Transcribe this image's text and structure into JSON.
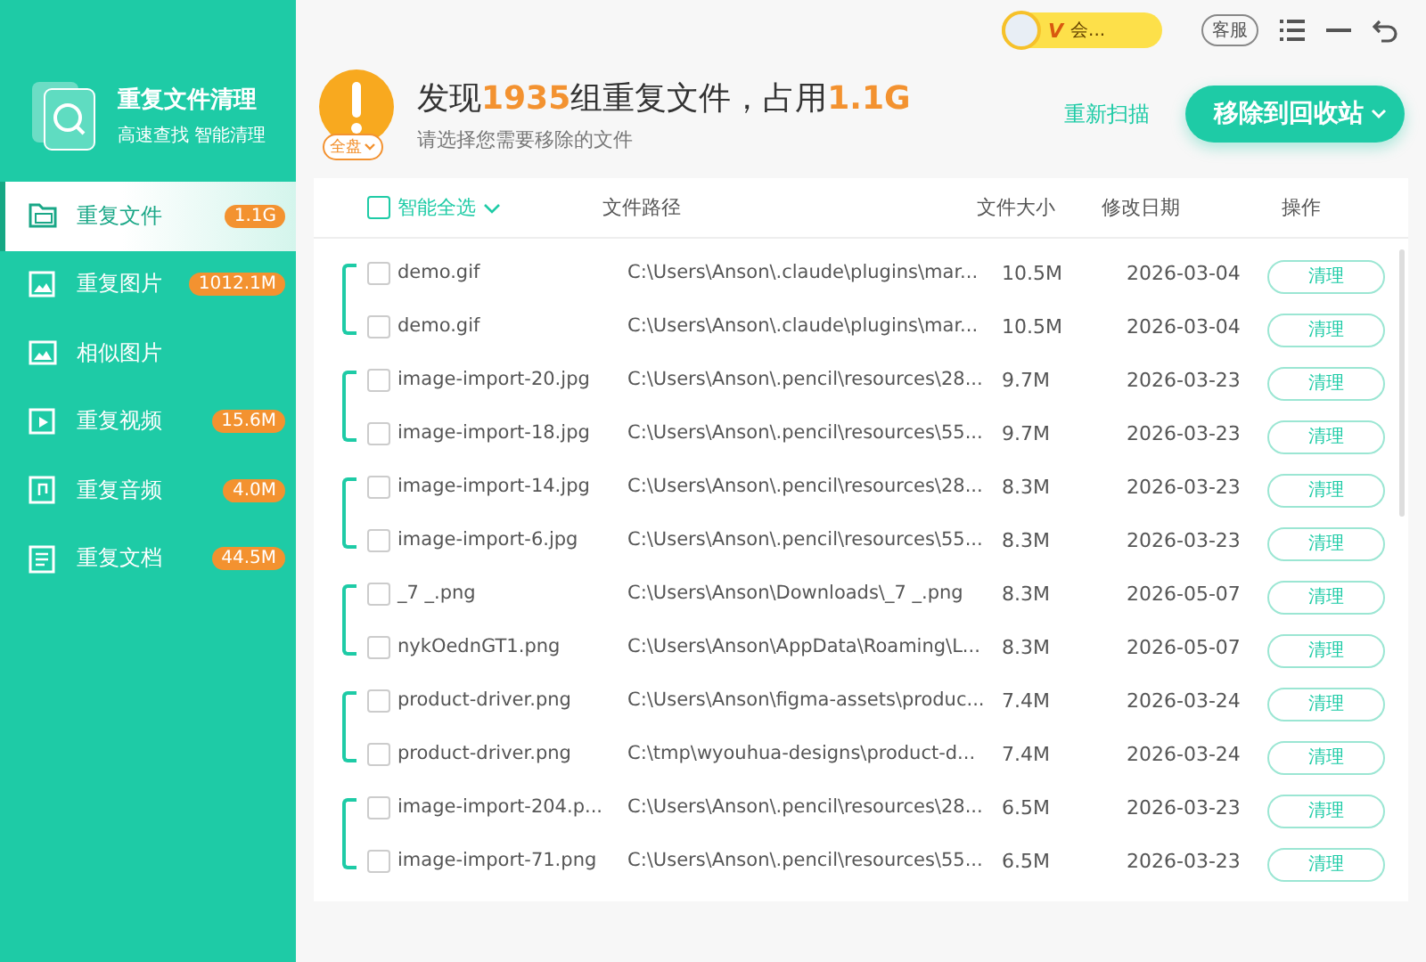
{
  "app": {
    "title": "重复文件清理",
    "subtitle": "高速查找 智能清理"
  },
  "sidebar": {
    "items": [
      {
        "label": "重复文件",
        "badge": "1.1G",
        "selected": true
      },
      {
        "label": "重复图片",
        "badge": "1012.1M",
        "selected": false
      },
      {
        "label": "相似图片",
        "selected": false
      },
      {
        "label": "重复视频",
        "badge": "15.6M",
        "selected": false
      },
      {
        "label": "重复音频",
        "badge": "4.0M",
        "selected": false
      },
      {
        "label": "重复文档",
        "badge": "44.5M",
        "selected": false
      }
    ]
  },
  "topbar": {
    "vip": "会...",
    "vip_mark": "V",
    "service": "客服"
  },
  "summary": {
    "scope": "全盘",
    "headline": "发现**1935**组重复文件，占用**1.1G**",
    "hint": "请选择您需要移除的文件",
    "rescan": "重新扫描",
    "remove": "移除到回收站"
  },
  "table": {
    "select_all": {
      "label": "智能全选",
      "checked": false
    },
    "columns": [
      "文件路径",
      "文件大小",
      "修改日期",
      "操作"
    ],
    "groups": [
      {
        "rows": [
          {
            "name": "demo.gif",
            "path": "C:\\Users\\Anson\\.claude\\plugins\\mar...",
            "size": "10.5M",
            "date": "2026-03-04",
            "action": "清理",
            "checked": false
          },
          {
            "name": "demo.gif",
            "path": "C:\\Users\\Anson\\.claude\\plugins\\mar...",
            "size": "10.5M",
            "date": "2026-03-04",
            "action": "清理",
            "checked": false
          }
        ]
      },
      {
        "rows": [
          {
            "name": "image-import-20.jpg",
            "path": "C:\\Users\\Anson\\.pencil\\resources\\28...",
            "size": "9.7M",
            "date": "2026-03-23",
            "action": "清理",
            "checked": false
          },
          {
            "name": "image-import-18.jpg",
            "path": "C:\\Users\\Anson\\.pencil\\resources\\55...",
            "size": "9.7M",
            "date": "2026-03-23",
            "action": "清理",
            "checked": false
          }
        ]
      },
      {
        "rows": [
          {
            "name": "image-import-14.jpg",
            "path": "C:\\Users\\Anson\\.pencil\\resources\\28...",
            "size": "8.3M",
            "date": "2026-03-23",
            "action": "清理",
            "checked": false
          },
          {
            "name": "image-import-6.jpg",
            "path": "C:\\Users\\Anson\\.pencil\\resources\\55...",
            "size": "8.3M",
            "date": "2026-03-23",
            "action": "清理",
            "checked": false
          }
        ]
      },
      {
        "rows": [
          {
            "name": "_7 _.png",
            "path": "C:\\Users\\Anson\\Downloads\\_7 _.png",
            "size": "8.3M",
            "date": "2026-05-07",
            "action": "清理",
            "checked": false
          },
          {
            "name": "nykOednGT1.png",
            "path": "C:\\Users\\Anson\\AppData\\Roaming\\L...",
            "size": "8.3M",
            "date": "2026-05-07",
            "action": "清理",
            "checked": false
          }
        ]
      },
      {
        "rows": [
          {
            "name": "product-driver.png",
            "path": "C:\\Users\\Anson\\figma-assets\\produc...",
            "size": "7.4M",
            "date": "2026-03-24",
            "action": "清理",
            "checked": false
          },
          {
            "name": "product-driver.png",
            "path": "C:\\tmp\\wyouhua-designs\\product-d...",
            "size": "7.4M",
            "date": "2026-03-24",
            "action": "清理",
            "checked": false
          }
        ]
      },
      {
        "rows": [
          {
            "name": "image-import-204.p...",
            "path": "C:\\Users\\Anson\\.pencil\\resources\\28...",
            "size": "6.5M",
            "date": "2026-03-23",
            "action": "清理",
            "checked": false
          },
          {
            "name": "image-import-71.png",
            "path": "C:\\Users\\Anson\\.pencil\\resources\\55...",
            "size": "6.5M",
            "date": "2026-03-23",
            "action": "清理",
            "checked": false
          }
        ]
      }
    ]
  }
}
